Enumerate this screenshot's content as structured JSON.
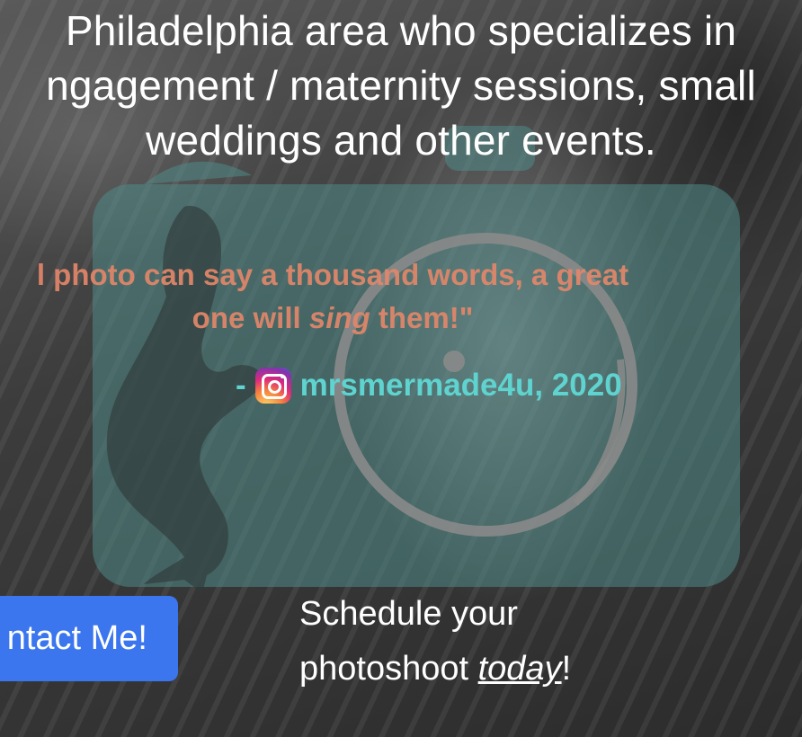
{
  "intro": {
    "line1": "Philadelphia area who specializes in",
    "line2": "ngagement / maternity sessions, small",
    "line3": "weddings and other events."
  },
  "quote": {
    "line1": "l photo can say a thousand words, a great",
    "line2_before": "one will ",
    "line2_emphasis": "sing",
    "line2_after": " them!\""
  },
  "attribution": {
    "dash": "-",
    "icon": "instagram-icon",
    "handle": "mrsmermade4u, 2020"
  },
  "cta": {
    "button_label": "ntact Me!",
    "schedule_line1": "Schedule your",
    "schedule_line2_before": "photoshoot ",
    "schedule_line2_emphasis": "today",
    "schedule_line2_after": "!"
  },
  "colors": {
    "button": "#3b76ee",
    "quote": "#e3876a",
    "attribution": "#5fd3cf",
    "logo_teal": "#4f7f7c"
  }
}
